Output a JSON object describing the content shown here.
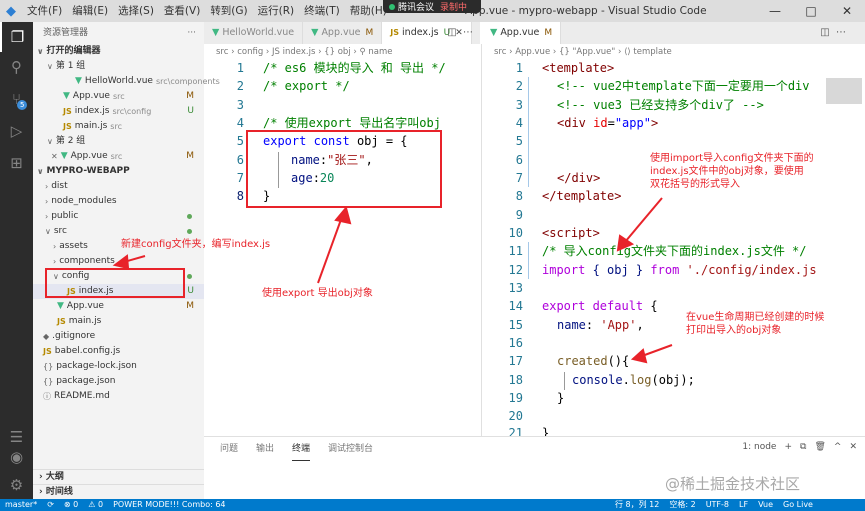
{
  "titlebar": {
    "menu": [
      "文件(F)",
      "编辑(E)",
      "选择(S)",
      "查看(V)",
      "转到(G)",
      "运行(R)",
      "终端(T)",
      "帮助(H)"
    ],
    "title": "App.vue - mypro-webapp - Visual Studio Code",
    "meeting": "腾讯会议",
    "recording": "录制中",
    "controls": [
      "—",
      "□",
      "✕"
    ]
  },
  "activitybar": {
    "scm_badge": "5"
  },
  "sidebar": {
    "header": "资源管理器",
    "more": "···",
    "open_editors": "打开的编辑器",
    "group1": "第 1 组",
    "group2": "第 2 组",
    "open_group1": [
      {
        "name": "HelloWorld.vue",
        "desc": "src\\components",
        "type": "vue",
        "status": ""
      },
      {
        "name": "App.vue",
        "desc": "src",
        "type": "vue",
        "status": "M"
      },
      {
        "name": "index.js",
        "desc": "src\\config",
        "type": "js",
        "status": "U"
      },
      {
        "name": "main.js",
        "desc": "src",
        "type": "js",
        "status": ""
      }
    ],
    "open_group2": [
      {
        "name": "App.vue",
        "desc": "src",
        "type": "vue",
        "status": "M"
      }
    ],
    "project": "MYPRO-WEBAPP",
    "tree": {
      "dist": "dist",
      "node_modules": "node_modules",
      "public": "public",
      "src": "src",
      "assets": "assets",
      "components": "components",
      "config": "config",
      "index_js": "index.js",
      "index_js_status": "U",
      "app_vue": "App.vue",
      "app_vue_status": "M",
      "main_js": "main.js",
      "gitignore": ".gitignore",
      "babel": "babel.config.js",
      "package_lock": "package-lock.json",
      "package": "package.json",
      "readme": "README.md"
    },
    "outline": "大纲",
    "timeline": "时间线"
  },
  "left_editor": {
    "tabs": [
      {
        "label": "HelloWorld.vue",
        "type": "vue",
        "mark": ""
      },
      {
        "label": "App.vue",
        "type": "vue",
        "mark": "M"
      },
      {
        "label": "index.js",
        "type": "js",
        "mark": "U"
      }
    ],
    "breadcrumb": "src › config › JS index.js › {} obj › ⚲ name",
    "lines": [
      "1",
      "2",
      "3",
      "4",
      "5",
      "6",
      "7",
      "8"
    ],
    "code": {
      "l1": "/* es6 模块的导入 和 导出 */",
      "l2": "/* export */",
      "l4": "/* 使用export 导出名字叫obj",
      "l5_kw1": "export",
      "l5_kw2": "const",
      "l5_rest": " obj = {",
      "l6_prop": "name",
      "l6_colon": ":",
      "l6_str": "\"张三\"",
      "l6_comma": ",",
      "l7_prop": "age",
      "l7_colon": ":",
      "l7_num": "20",
      "l8": "}"
    }
  },
  "right_editor": {
    "tab": {
      "label": "App.vue",
      "mark": "M"
    },
    "breadcrumb": "src › App.vue › {} \"App.vue\" › ⟨⟩ template",
    "lines": [
      "1",
      "2",
      "3",
      "4",
      "5",
      "6",
      "7",
      "8",
      "9",
      "10",
      "11",
      "12",
      "13",
      "14",
      "15",
      "16",
      "17",
      "18",
      "19",
      "20",
      "21"
    ],
    "code": {
      "l1": "<template>",
      "l2": "<!-- vue2中template下面一定要用一个div",
      "l3": "<!-- vue3 已经支持多个div了 -->",
      "l4_tag": "<div",
      "l4_attr": " id",
      "l4_eq": "=",
      "l4_str": "\"app\"",
      "l4_close": ">",
      "l7": "</div>",
      "l8": "</template>",
      "l10": "<script>",
      "l11": "/* 导入config文件夹下面的index.js文件 */",
      "l12_kw": "import",
      "l12_mid": " { obj } ",
      "l12_from": "from",
      "l12_str": " './config/index.js",
      "l14_kw1": "export",
      "l14_kw2": " default",
      "l14_rest": " {",
      "l15_prop": "name",
      "l15_colon": ": ",
      "l15_str": "'App'",
      "l15_comma": ",",
      "l17_fn": "created",
      "l17_rest": "(){",
      "l18_obj": "console",
      "l18_dot": ".",
      "l18_fn": "log",
      "l18_rest": "(obj);",
      "l19": "}",
      "l21": "}"
    }
  },
  "panel": {
    "tabs": [
      "问题",
      "输出",
      "终端",
      "调试控制台"
    ],
    "active": "终端",
    "terminal": "1: node",
    "actions": [
      "+",
      "⧉",
      "🗑",
      "^",
      "✕"
    ]
  },
  "statusbar": {
    "branch": "master*",
    "sync": "⟳",
    "errors": "⊗ 0",
    "warnings": "⚠ 0",
    "power": "POWER MODE!!! Combo: 64",
    "position": "行 8，列 12",
    "spaces": "空格: 2",
    "encoding": "UTF-8",
    "eol": "LF",
    "language": "Vue",
    "golive": "Go Live"
  },
  "annotations": {
    "config_note": "新建config文件夹，编写index.js",
    "export_note": "使用export 导出obj对象",
    "import_note": [
      "使用import导入config文件夹下面的",
      "index.js文件中的obj对象，要使用",
      "双花括号的形式导入"
    ],
    "created_note": [
      "在vue生命周期已经创建的时候",
      "打印出导入的obj对象"
    ]
  },
  "watermark": "@稀土掘金技术社区",
  "colors": {
    "statusbar": "#007acc",
    "activitybar": "#2c2c2c",
    "sidebar": "#f3f3f3",
    "annotation": "#e8232a"
  }
}
